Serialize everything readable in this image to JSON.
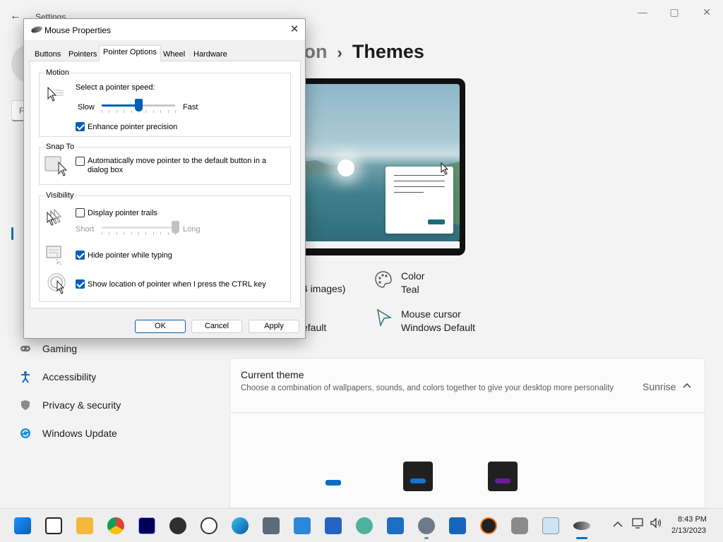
{
  "settings": {
    "window_title": "Settings",
    "back_glyph": "←",
    "controls": {
      "minimize": "—",
      "maximize": "▢",
      "close": "✕"
    },
    "search_placeholder": "F",
    "nav": [
      {
        "label": "Gaming",
        "icon": "gamepad-icon"
      },
      {
        "label": "Accessibility",
        "icon": "accessibility-icon"
      },
      {
        "label": "Privacy & security",
        "icon": "shield-icon"
      },
      {
        "label": "Windows Update",
        "icon": "update-icon"
      }
    ],
    "breadcrumb": {
      "parent": "ization",
      "separator": "›",
      "current": "Themes"
    },
    "partial_texts": [
      ")",
      "4 images)",
      "efault"
    ],
    "properties": {
      "color": {
        "title": "Color",
        "value": "Teal"
      },
      "cursor": {
        "title": "Mouse cursor",
        "value": "Windows Default"
      }
    },
    "current_theme": {
      "title": "Current theme",
      "description": "Choose a combination of wallpapers, sounds, and colors together to give your desktop more personality",
      "value": "Sunrise",
      "chevron": "^"
    },
    "colors": {
      "accent": "#0a6fc2",
      "teal": "#1e6e76",
      "purple": "#6a1b9a",
      "blue": "#1273d3"
    }
  },
  "dialog": {
    "title": "Mouse Properties",
    "close_glyph": "✕",
    "tabs": [
      "Buttons",
      "Pointers",
      "Pointer Options",
      "Wheel",
      "Hardware"
    ],
    "active_tab": "Pointer Options",
    "motion": {
      "label": "Motion",
      "speed_label": "Select a pointer speed:",
      "slow": "Slow",
      "fast": "Fast",
      "speed_value": 0.5,
      "enhance_label": "Enhance pointer precision",
      "enhance_checked": true
    },
    "snap_to": {
      "label": "Snap To",
      "auto_move_label": "Automatically move pointer to the default button in a dialog box",
      "auto_move_line1": "Automatically move pointer to the default button in a",
      "auto_move_line2": "dialog box",
      "auto_move_checked": false
    },
    "visibility": {
      "label": "Visibility",
      "trails_label": "Display pointer trails",
      "trails_checked": false,
      "short": "Short",
      "long": "Long",
      "trails_value": 1.0,
      "hide_label": "Hide pointer while typing",
      "hide_checked": true,
      "ctrl_label": "Show location of pointer when I press the CTRL key",
      "ctrl_checked": true
    },
    "buttons": {
      "ok": "OK",
      "cancel": "Cancel",
      "apply": "Apply"
    }
  },
  "taskbar": {
    "apps": [
      "start-icon",
      "task-view-icon",
      "file-explorer-icon",
      "chrome-icon",
      "premiere-icon",
      "obs-icon",
      "clock-app-icon",
      "edge-icon",
      "calculator-icon",
      "notepad-icon",
      "store-icon",
      "maps-icon",
      "photos-icon",
      "settings-icon",
      "movies-icon",
      "media-player-icon",
      "microphone-icon",
      "image-viewer-icon",
      "mouse-icon"
    ],
    "time": "8:43 PM",
    "date": "2/13/2023"
  }
}
